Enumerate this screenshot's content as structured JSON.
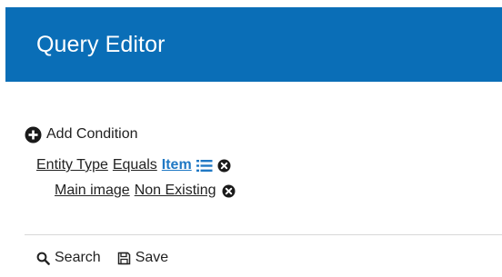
{
  "header": {
    "title": "Query Editor"
  },
  "add_condition": {
    "label": "Add Condition",
    "icon": "plus-circle-icon"
  },
  "conditions": [
    {
      "field": "Entity Type",
      "operator": "Equals",
      "value": "Item",
      "icons": [
        "list-icon",
        "remove-icon"
      ]
    },
    {
      "field": "Main image",
      "operator": "Non Existing",
      "icons": [
        "remove-icon"
      ]
    }
  ],
  "footer": {
    "search_label": "Search",
    "save_label": "Save"
  },
  "colors": {
    "header_bg": "#0a6eb7",
    "value_link": "#1f78c4",
    "divider": "#d8d8d8"
  }
}
